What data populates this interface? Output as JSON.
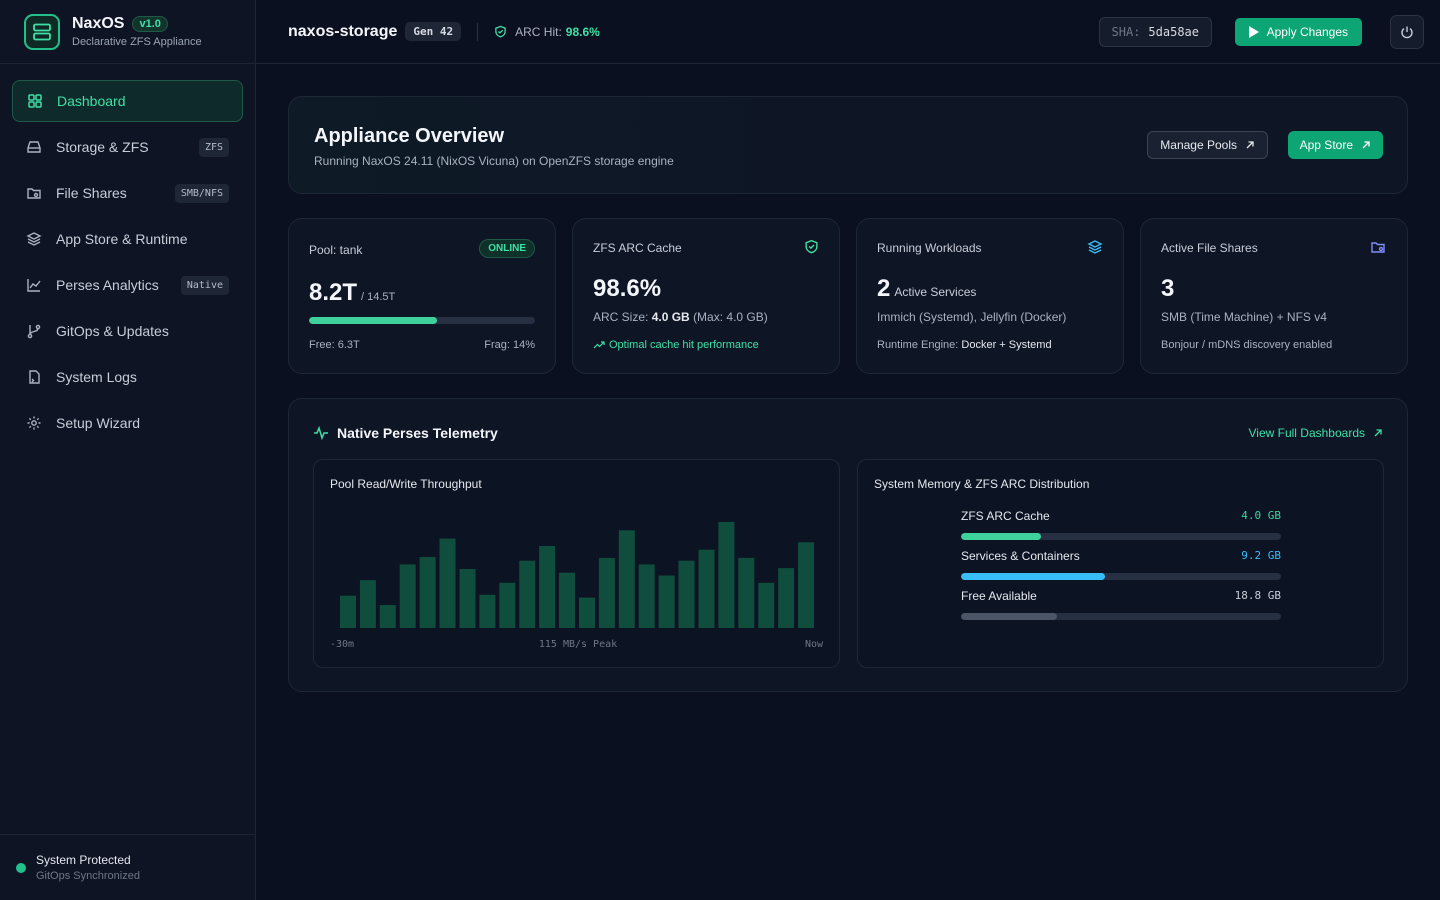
{
  "brand": {
    "name": "NaxOS",
    "version": "v1.0",
    "subtitle": "Declarative ZFS Appliance"
  },
  "sidebar": {
    "items": [
      {
        "label": "Dashboard",
        "icon": "grid-icon",
        "tag": ""
      },
      {
        "label": "Storage & ZFS",
        "icon": "hard-drive-icon",
        "tag": "ZFS"
      },
      {
        "label": "File Shares",
        "icon": "folder-share-icon",
        "tag": "SMB/NFS"
      },
      {
        "label": "App Store & Runtime",
        "icon": "layers-icon",
        "tag": ""
      },
      {
        "label": "Perses Analytics",
        "icon": "line-chart-icon",
        "tag": "Native"
      },
      {
        "label": "GitOps & Updates",
        "icon": "git-branch-icon",
        "tag": ""
      },
      {
        "label": "System Logs",
        "icon": "file-log-icon",
        "tag": ""
      },
      {
        "label": "Setup Wizard",
        "icon": "gear-icon",
        "tag": ""
      }
    ],
    "footer": {
      "title": "System Protected",
      "subtitle": "GitOps Synchronized"
    }
  },
  "topbar": {
    "hostname": "naxos-storage",
    "generation": "Gen 42",
    "arc_label": "ARC Hit:",
    "arc_value": "98.6%",
    "sha_label": "SHA:",
    "sha_value": "5da58ae",
    "apply_label": "Apply Changes"
  },
  "overview": {
    "title": "Appliance Overview",
    "subtitle": "Running NaxOS 24.11 (NixOS Vicuna) on OpenZFS storage engine",
    "manage_label": "Manage Pools",
    "appstore_label": "App Store"
  },
  "stats": {
    "pool": {
      "label": "Pool: tank",
      "status": "ONLINE",
      "used": "8.2T",
      "total": "/ 14.5T",
      "usage_fraction": 0.565,
      "free": "Free: 6.3T",
      "frag": "Frag: 14%"
    },
    "arc": {
      "label": "ZFS ARC Cache",
      "value": "98.6%",
      "size_prefix": "ARC Size:",
      "size_value": "4.0 GB",
      "size_suffix": "(Max: 4.0 GB)",
      "note": "Optimal cache hit performance"
    },
    "workloads": {
      "label": "Running Workloads",
      "value": "2",
      "unit": "Active Services",
      "services": "Immich (Systemd), Jellyfin (Docker)",
      "engine_prefix": "Runtime Engine:",
      "engine_value": "Docker + Systemd"
    },
    "shares": {
      "label": "Active File Shares",
      "value": "3",
      "protocols": "SMB (Time Machine) + NFS v4",
      "discovery": "Bonjour / mDNS discovery enabled"
    }
  },
  "telemetry": {
    "title": "Native Perses Telemetry",
    "link_label": "View Full Dashboards",
    "throughput": {
      "title": "Pool Read/Write Throughput",
      "start_label": "-30m",
      "peak_label": "115 MB/s Peak",
      "end_label": "Now"
    },
    "memory": {
      "title": "System Memory & ZFS ARC Distribution",
      "rows": [
        {
          "label": "ZFS ARC Cache",
          "value": "4.0",
          "unit": "GB",
          "fraction": 0.25,
          "color": "#3fd19c"
        },
        {
          "label": "Services & Containers",
          "value": "9.2",
          "unit": "GB",
          "fraction": 0.45,
          "color": "#38bdf8"
        },
        {
          "label": "Free Available",
          "value": "18.8",
          "unit": "GB",
          "fraction": 0.3,
          "color": "#4b5566"
        }
      ]
    }
  },
  "chart_data": {
    "type": "bar",
    "title": "Pool Read/Write Throughput",
    "unit": "MB/s",
    "x_start": "-30m",
    "x_end": "Now",
    "values": [
      35,
      52,
      25,
      69,
      77,
      97,
      64,
      36,
      49,
      73,
      89,
      60,
      33,
      76,
      106,
      69,
      57,
      73,
      85,
      115,
      76,
      49,
      65,
      93
    ],
    "ylim": [
      0,
      115
    ],
    "color": "#0f4d3c"
  }
}
